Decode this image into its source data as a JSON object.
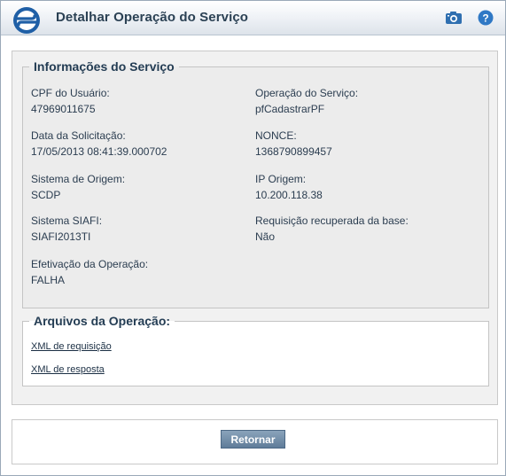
{
  "window": {
    "title": "Detalhar Operação do Serviço",
    "icons": {
      "logo": "serpro-logo-icon",
      "camera": "camera-icon",
      "help": "help-icon"
    }
  },
  "info_section": {
    "legend": "Informações do Serviço",
    "fields": [
      {
        "label": "CPF do Usuário:",
        "value": "47969011675"
      },
      {
        "label": "Operação do Serviço:",
        "value": "pfCadastrarPF"
      },
      {
        "label": "Data da Solicitação:",
        "value": "17/05/2013 08:41:39.000702"
      },
      {
        "label": "NONCE:",
        "value": "1368790899457"
      },
      {
        "label": "Sistema de Origem:",
        "value": "SCDP"
      },
      {
        "label": "IP Origem:",
        "value": "10.200.118.38"
      },
      {
        "label": "Sistema SIAFI:",
        "value": "SIAFI2013TI"
      },
      {
        "label": "Requisição recuperada da base:",
        "value": "Não"
      },
      {
        "label": "Efetivação da Operação:",
        "value": "FALHA"
      }
    ]
  },
  "files_section": {
    "legend": "Arquivos da Operação:",
    "links": [
      {
        "label": "XML de requisição"
      },
      {
        "label": "XML de resposta"
      }
    ]
  },
  "footer": {
    "return_label": "Retornar"
  },
  "colors": {
    "button": "#6f8aa6",
    "title": "#2b4154",
    "help": "#2f78c5",
    "logo": "#1f5fa6"
  }
}
